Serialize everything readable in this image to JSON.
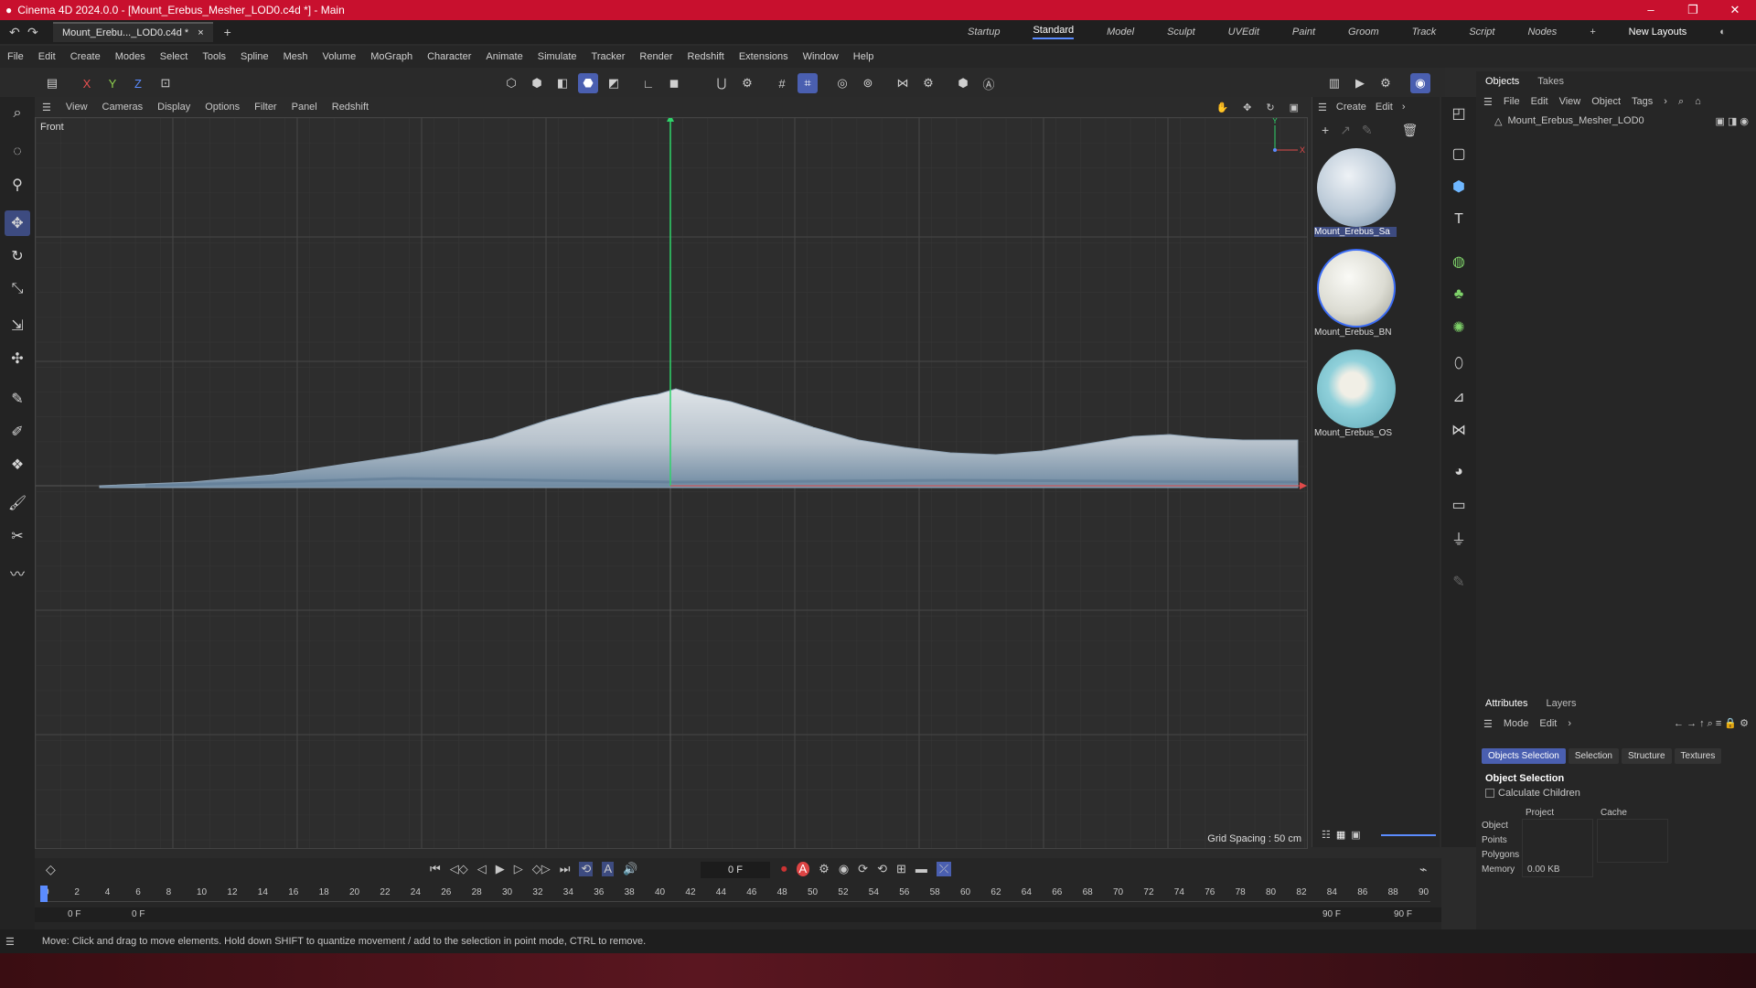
{
  "window": {
    "title": "Cinema 4D 2024.0.0 - [Mount_Erebus_Mesher_LOD0.c4d *] - Main"
  },
  "doc_tab": "Mount_Erebu..._LOD0.c4d *",
  "layouts": [
    "Startup",
    "Standard",
    "Model",
    "Sculpt",
    "UVEdit",
    "Paint",
    "Groom",
    "Track",
    "Script",
    "Nodes"
  ],
  "layouts_button": "New Layouts",
  "menu": [
    "File",
    "Edit",
    "Create",
    "Modes",
    "Select",
    "Tools",
    "Spline",
    "Mesh",
    "Volume",
    "MoGraph",
    "Character",
    "Animate",
    "Simulate",
    "Tracker",
    "Render",
    "Redshift",
    "Extensions",
    "Window",
    "Help"
  ],
  "axes": {
    "x": "X",
    "y": "Y",
    "z": "Z"
  },
  "viewport_menu": [
    "View",
    "Cameras",
    "Display",
    "Options",
    "Filter",
    "Panel",
    "Redshift"
  ],
  "viewport": {
    "name": "Front",
    "grid_spacing": "Grid Spacing : 50 cm"
  },
  "material_menu": {
    "create": "Create",
    "edit": "Edit"
  },
  "materials": [
    {
      "name": "Mount_Erebus_Sa",
      "color": "#c9d6e2"
    },
    {
      "name": "Mount_Erebus_BN",
      "color": "#e4e4df"
    },
    {
      "name": "Mount_Erebus_OS",
      "color": "#8fcfd8"
    }
  ],
  "objects_panel": {
    "tabs": [
      "Objects",
      "Takes"
    ],
    "menu": [
      "File",
      "Edit",
      "View",
      "Object",
      "Tags"
    ],
    "item": "Mount_Erebus_Mesher_LOD0"
  },
  "attributes_panel": {
    "tabs": [
      "Attributes",
      "Layers"
    ],
    "menu": [
      "Mode",
      "Edit"
    ],
    "chips": [
      "Objects Selection",
      "Selection",
      "Structure",
      "Textures"
    ],
    "heading": "Object Selection",
    "checkbox": "Calculate Children",
    "cols": [
      "Project",
      "Cache"
    ],
    "rows": [
      {
        "label": "Object",
        "project": "",
        "cache": ""
      },
      {
        "label": "Points",
        "project": "",
        "cache": ""
      },
      {
        "label": "Polygons",
        "project": "",
        "cache": ""
      },
      {
        "label": "Memory",
        "project": "0.00 KB",
        "cache": ""
      }
    ]
  },
  "timeline": {
    "current_frame": "0 F",
    "start": "0 F",
    "start2": "0 F",
    "end": "90 F",
    "end2": "90 F",
    "ticks": [
      "0",
      "2",
      "4",
      "6",
      "8",
      "10",
      "12",
      "14",
      "16",
      "18",
      "20",
      "22",
      "24",
      "26",
      "28",
      "30",
      "32",
      "34",
      "36",
      "38",
      "40",
      "42",
      "44",
      "46",
      "48",
      "50",
      "52",
      "54",
      "56",
      "58",
      "60",
      "62",
      "64",
      "66",
      "68",
      "70",
      "72",
      "74",
      "76",
      "78",
      "80",
      "82",
      "84",
      "86",
      "88",
      "90"
    ]
  },
  "status": "Move: Click and drag to move elements. Hold down SHIFT to quantize movement / add to the selection in point mode, CTRL to remove."
}
